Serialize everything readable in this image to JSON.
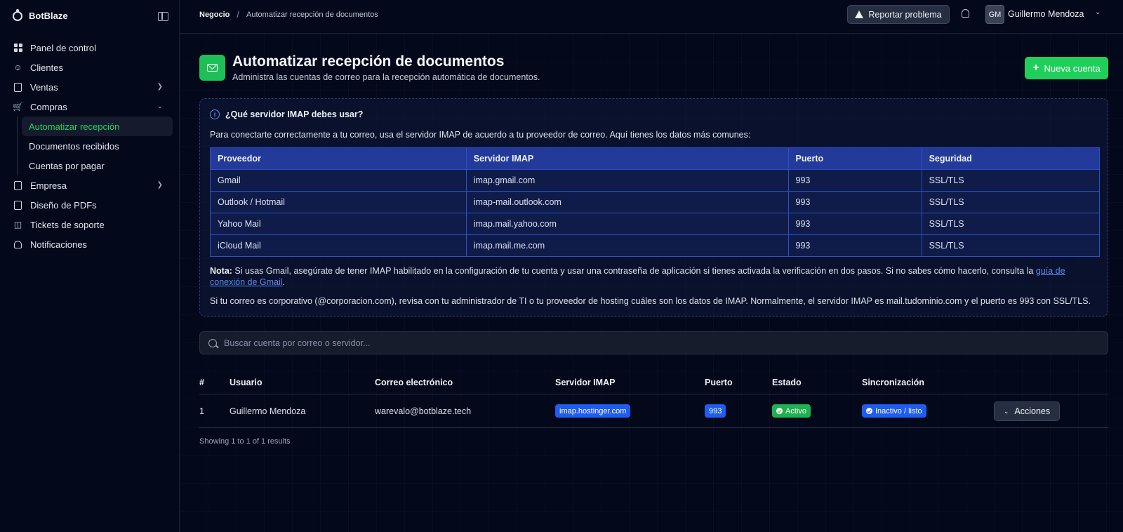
{
  "app": {
    "name": "BotBlaze"
  },
  "sidebar": {
    "items": [
      {
        "label": "Panel de control"
      },
      {
        "label": "Clientes"
      },
      {
        "label": "Ventas"
      },
      {
        "label": "Compras"
      },
      {
        "label": "Empresa"
      },
      {
        "label": "Diseño de PDFs"
      },
      {
        "label": "Tickets de soporte"
      },
      {
        "label": "Notificaciones"
      }
    ],
    "compras_sub": [
      {
        "label": "Automatizar recepción"
      },
      {
        "label": "Documentos recibidos"
      },
      {
        "label": "Cuentas por pagar"
      }
    ]
  },
  "header": {
    "breadcrumb": [
      "Negocio",
      "Automatizar recepción de documentos"
    ],
    "report_label": "Reportar problema",
    "avatar_initials": "GM",
    "user_name": "Guillermo Mendoza"
  },
  "page": {
    "title": "Automatizar recepción de documentos",
    "subtitle": "Administra las cuentas de correo para la recepción automática de documentos.",
    "new_button": "Nueva cuenta"
  },
  "info": {
    "heading": "¿Qué servidor IMAP debes usar?",
    "intro": "Para conectarte correctamente a tu correo, usa el servidor IMAP de acuerdo a tu proveedor de correo. Aquí tienes los datos más comunes:",
    "columns": [
      "Proveedor",
      "Servidor IMAP",
      "Puerto",
      "Seguridad"
    ],
    "rows": [
      [
        "Gmail",
        "imap.gmail.com",
        "993",
        "SSL/TLS"
      ],
      [
        "Outlook / Hotmail",
        "imap-mail.outlook.com",
        "993",
        "SSL/TLS"
      ],
      [
        "Yahoo Mail",
        "imap.mail.yahoo.com",
        "993",
        "SSL/TLS"
      ],
      [
        "iCloud Mail",
        "imap.mail.me.com",
        "993",
        "SSL/TLS"
      ]
    ],
    "note_label": "Nota:",
    "note_text": " Si usas Gmail, asegúrate de tener IMAP habilitado en la configuración de tu cuenta y usar una contraseña de aplicación si tienes activada la verificación en dos pasos. Si no sabes cómo hacerlo, consulta la ",
    "note_link": "guía de conexión de Gmail",
    "note_end": ".",
    "corporate": "Si tu correo es corporativo (@corporacion.com), revisa con tu administrador de TI o tu proveedor de hosting cuáles son los datos de IMAP. Normalmente, el servidor IMAP es mail.tudominio.com y el puerto es 993 con SSL/TLS."
  },
  "search": {
    "placeholder": "Buscar cuenta por correo o servidor..."
  },
  "accounts": {
    "columns": [
      "#",
      "Usuario",
      "Correo electrónico",
      "Servidor IMAP",
      "Puerto",
      "Estado",
      "Sincronización"
    ],
    "rows": [
      {
        "num": "1",
        "user": "Guillermo Mendoza",
        "email": "warevalo@botblaze.tech",
        "server": "imap.hostinger.com",
        "port": "993",
        "status": "Activo",
        "sync": "Inactivo / listo",
        "actions": "Acciones"
      }
    ],
    "footer": "Showing 1 to 1 of 1 results"
  },
  "colors": {
    "accent": "#1fcf5b",
    "primary_blue": "#1f5cf0",
    "background": "#03081a"
  }
}
